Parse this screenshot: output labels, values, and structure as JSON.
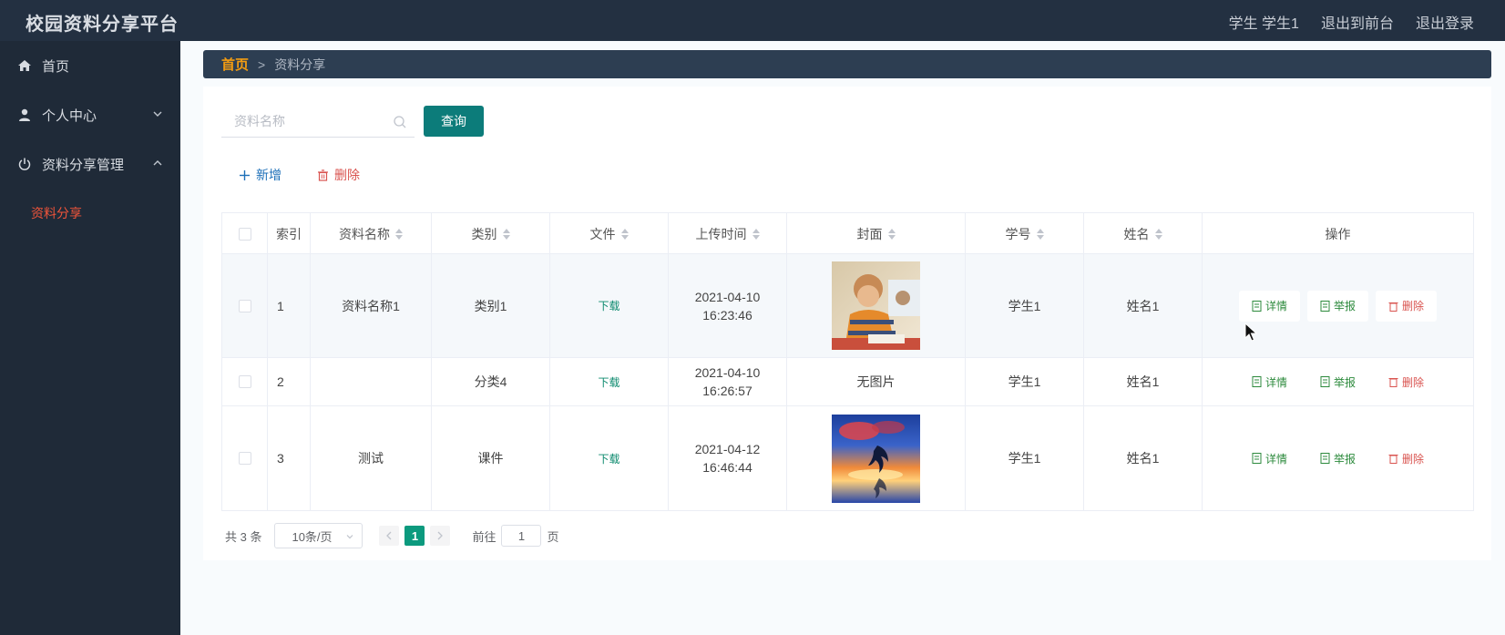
{
  "header": {
    "title": "校园资料分享平台",
    "user_label": "学生 学生1",
    "to_front": "退出到前台",
    "logout": "退出登录"
  },
  "sidebar": {
    "items": [
      {
        "label": "首页",
        "icon": "home-icon"
      },
      {
        "label": "个人中心",
        "icon": "user-icon"
      },
      {
        "label": "资料分享管理",
        "icon": "power-icon"
      }
    ],
    "sub_items": [
      {
        "label": "资料分享"
      }
    ]
  },
  "breadcrumb": {
    "home": "首页",
    "sep": ">",
    "current": "资料分享"
  },
  "search": {
    "placeholder": "资料名称",
    "value": "",
    "query_button": "查询"
  },
  "actions": {
    "add": "新增",
    "delete": "删除"
  },
  "table": {
    "columns": [
      "索引",
      "资料名称",
      "类别",
      "文件",
      "上传时间",
      "封面",
      "学号",
      "姓名",
      "操作"
    ],
    "rows": [
      {
        "index": "1",
        "name": "资料名称1",
        "category": "类别1",
        "file": "下载",
        "time": "2021-04-10 16:23:46",
        "cover": "image",
        "cover_text": "",
        "student_no": "学生1",
        "student_name": "姓名1"
      },
      {
        "index": "2",
        "name": "",
        "category": "分类4",
        "file": "下载",
        "time": "2021-04-10 16:26:57",
        "cover": "none",
        "cover_text": "无图片",
        "student_no": "学生1",
        "student_name": "姓名1"
      },
      {
        "index": "3",
        "name": "测试",
        "category": "课件",
        "file": "下载",
        "time": "2021-04-12 16:46:44",
        "cover": "image",
        "cover_text": "",
        "student_no": "学生1",
        "student_name": "姓名1"
      }
    ],
    "ops": {
      "detail": "详情",
      "report": "举报",
      "delete": "删除"
    }
  },
  "pagination": {
    "total": "共 3 条",
    "page_size": "10条/页",
    "current": "1",
    "goto_label": "前往",
    "goto_value": "1",
    "unit": "页"
  },
  "colors": {
    "topbar": "#233041",
    "sidebar": "#1f2a38",
    "accent": "#0c7c7a",
    "active_submenu": "#f0543a",
    "breadcrumb_home": "#f39c12"
  }
}
